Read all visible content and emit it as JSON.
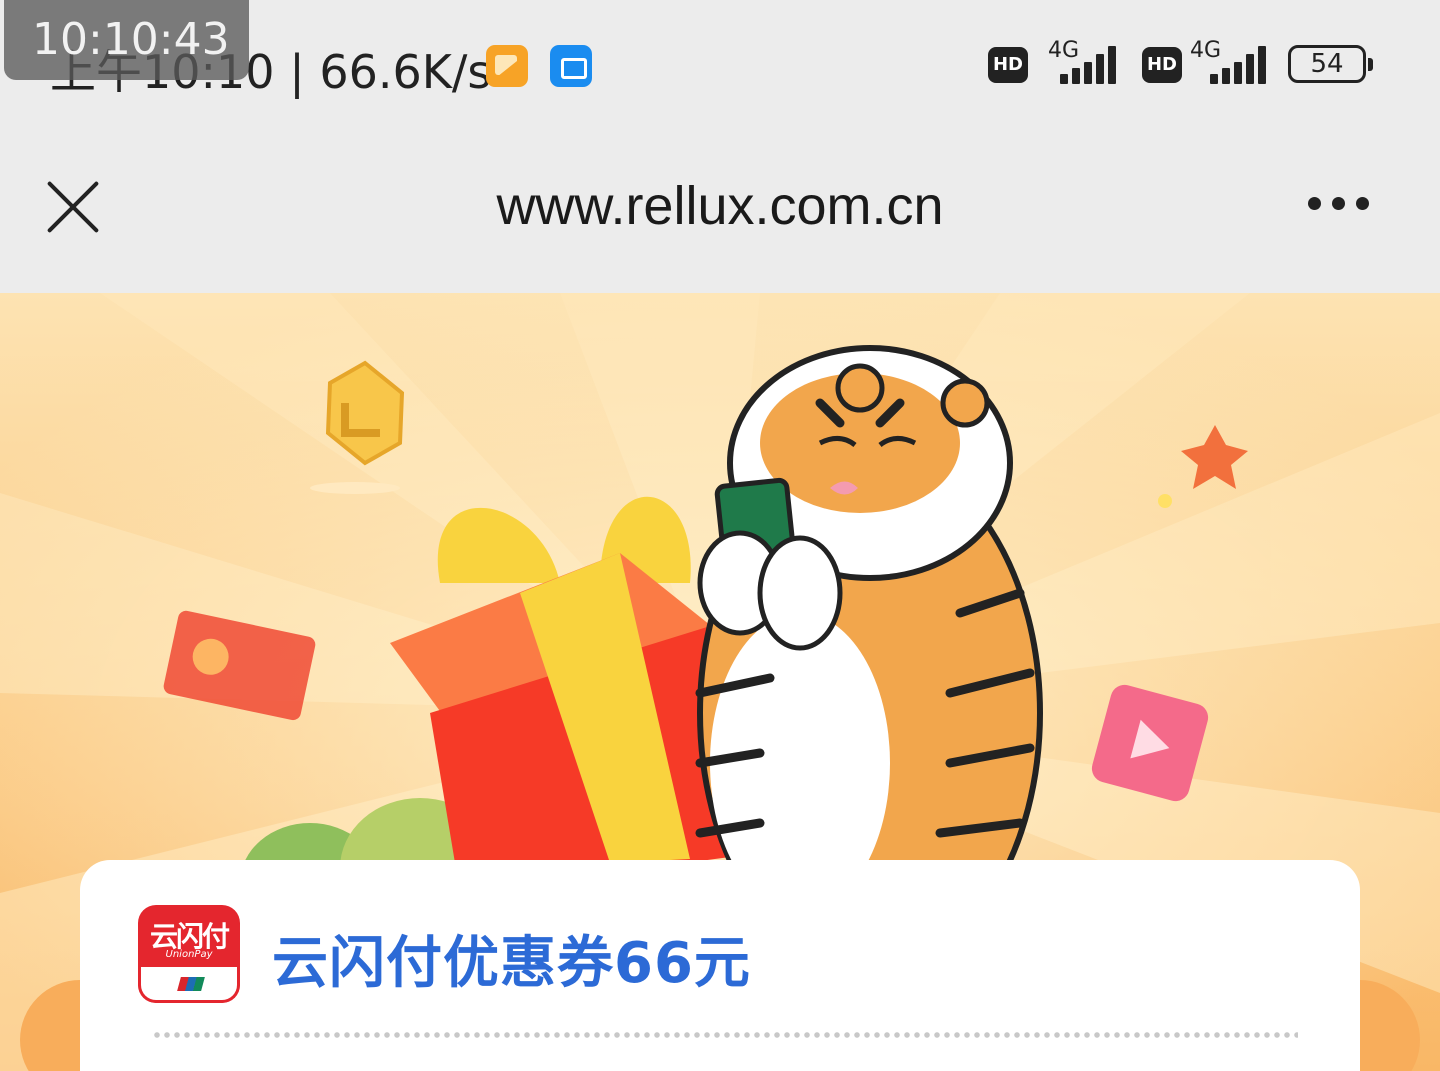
{
  "status_bar": {
    "time": "上午10:10",
    "speed": "66.6K/s",
    "overlay_time": "10:10:43",
    "sim1": {
      "hd": "HD",
      "network": "4G"
    },
    "sim2": {
      "hd": "HD",
      "network": "4G"
    },
    "battery": "54",
    "icons": [
      "gallery-icon",
      "print-icon",
      "signal-icon",
      "battery-icon"
    ]
  },
  "nav": {
    "url": "www.rellux.com.cn",
    "icons": [
      "close-icon",
      "more-icon"
    ]
  },
  "coupon": {
    "logo_text": "云闪付",
    "logo_sub": "UnionPay",
    "title": "云闪付优惠券66元"
  },
  "colors": {
    "banner_top": "#fde3b2",
    "banner_bottom": "#f9b766",
    "title": "#2c6ad6",
    "logo": "#e4262e"
  }
}
